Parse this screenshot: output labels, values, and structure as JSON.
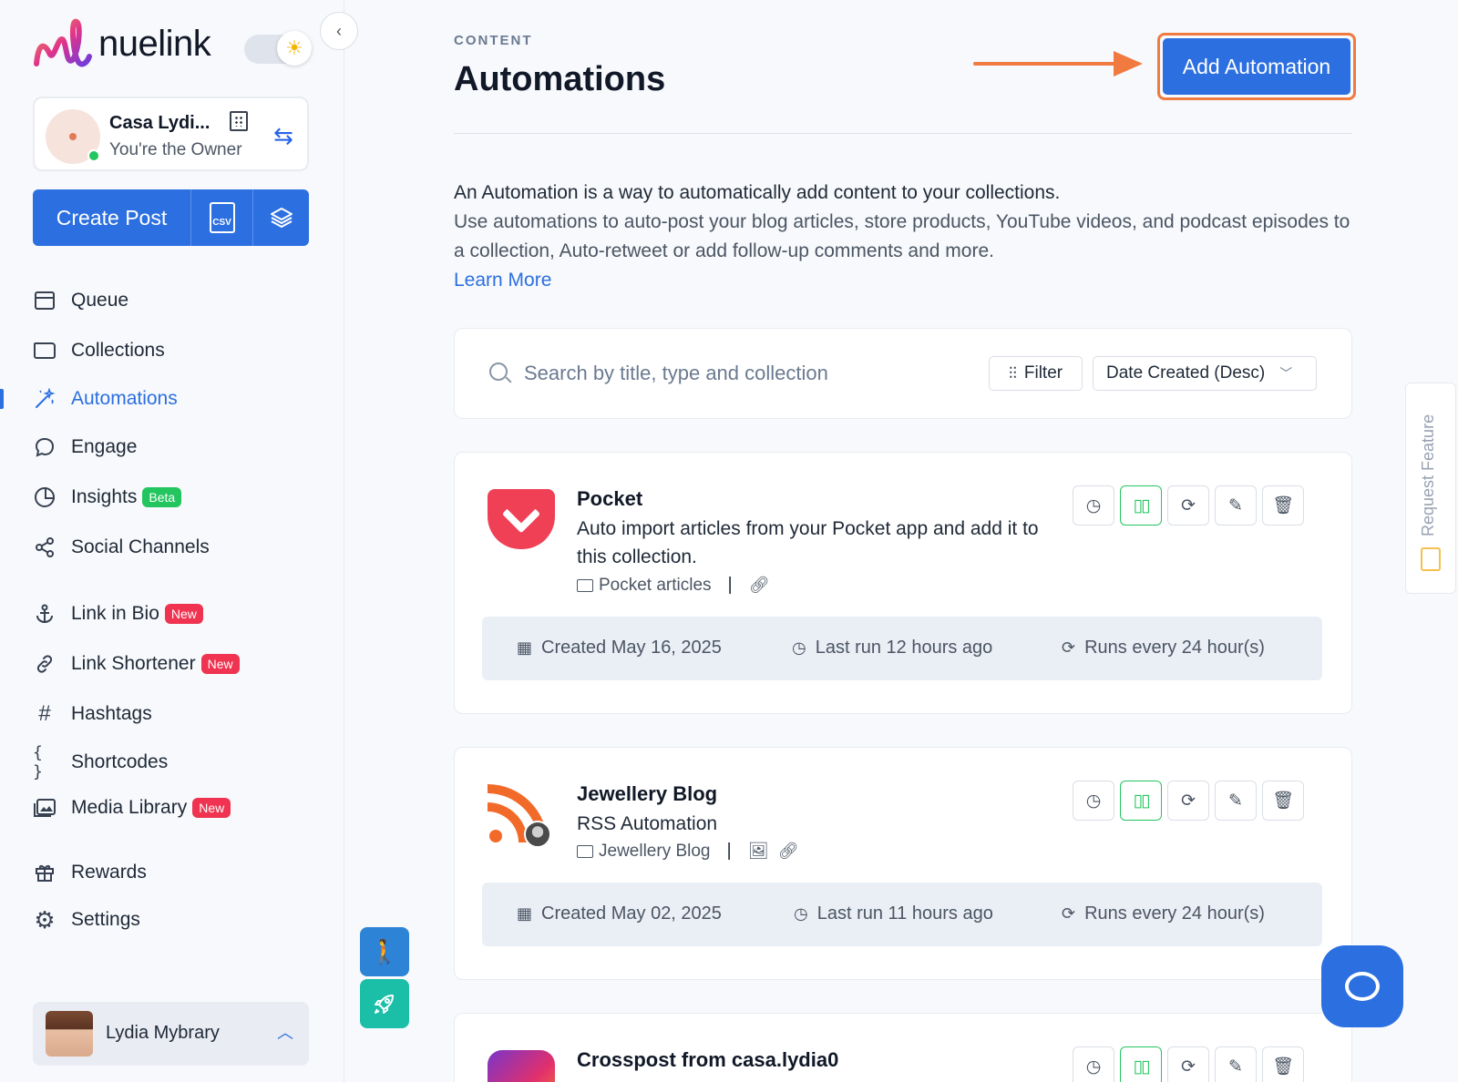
{
  "app": {
    "name": "nuelink"
  },
  "account": {
    "name": "Casa Lydi...",
    "role": "You're the Owner"
  },
  "create": {
    "label": "Create Post",
    "csv_label": "CSV"
  },
  "nav": {
    "items": [
      {
        "label": "Queue"
      },
      {
        "label": "Collections"
      },
      {
        "label": "Automations",
        "active": true
      },
      {
        "label": "Engage"
      },
      {
        "label": "Insights",
        "badge": "Beta"
      },
      {
        "label": "Social Channels"
      },
      {
        "label": "Link in Bio",
        "badge": "New"
      },
      {
        "label": "Link Shortener",
        "badge": "New"
      },
      {
        "label": "Hashtags"
      },
      {
        "label": "Shortcodes"
      },
      {
        "label": "Media Library",
        "badge": "New"
      },
      {
        "label": "Rewards"
      },
      {
        "label": "Settings"
      }
    ]
  },
  "user": {
    "name": "Lydia Mybrary"
  },
  "header": {
    "eyebrow": "CONTENT",
    "title": "Automations",
    "add_label": "Add Automation"
  },
  "intro": {
    "line1": "An Automation is a way to automatically add content to your collections.",
    "line2": "Use automations to auto-post your blog articles, store products, YouTube videos, and podcast episodes to a collection, Auto-retweet or add follow-up comments and more.",
    "learn_more": "Learn More"
  },
  "search": {
    "placeholder": "Search by title, type and collection",
    "filter_label": "Filter",
    "sort_label": "Date Created (Desc)"
  },
  "automations": [
    {
      "title": "Pocket",
      "description": "Auto import articles from your Pocket app and add it to this collection.",
      "collection": "Pocket articles",
      "created": "Created May 16, 2025",
      "last_run": "Last run 12 hours ago",
      "runs": "Runs every 24 hour(s)"
    },
    {
      "title": "Jewellery Blog",
      "description": "RSS Automation",
      "collection": "Jewellery Blog",
      "created": "Created May 02, 2025",
      "last_run": "Last run 11 hours ago",
      "runs": "Runs every 24 hour(s)"
    },
    {
      "title": "Crosspost from casa.lydia0"
    }
  ],
  "side_widget": {
    "label": "Request Feature"
  },
  "colors": {
    "brand": "#2c6fe0",
    "highlight": "#f07a3f",
    "success": "#22c55e",
    "new_badge": "#ef3350"
  }
}
